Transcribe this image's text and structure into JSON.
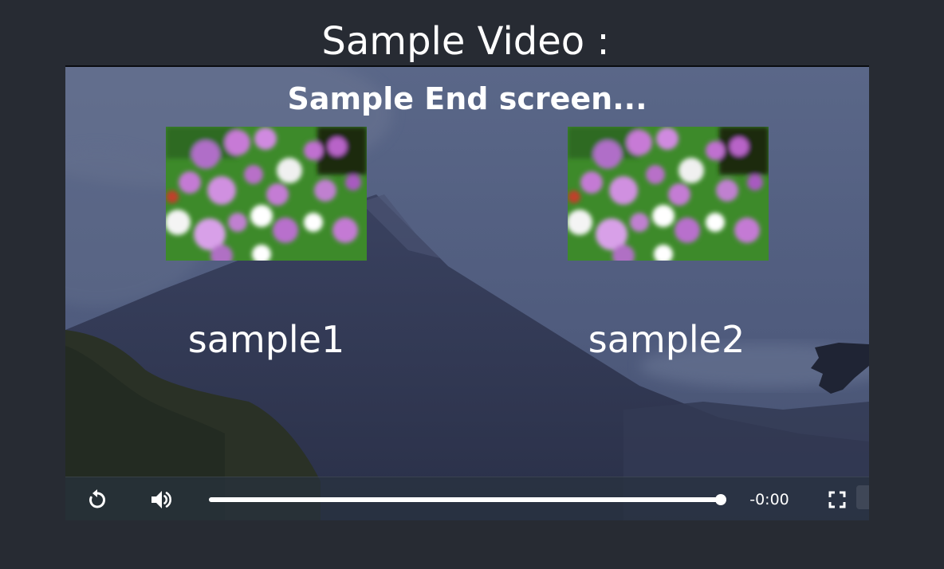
{
  "page": {
    "title": "Sample Video :"
  },
  "player": {
    "end_screen": {
      "title": "Sample End screen...",
      "items": [
        {
          "label": "sample1"
        },
        {
          "label": "sample2"
        }
      ]
    },
    "controls": {
      "replay_icon": "replay-icon",
      "volume_icon": "volume-icon",
      "fullscreen_icon": "fullscreen-icon",
      "time_remaining": "-0:00",
      "progress": 1.0
    }
  },
  "colors": {
    "page_background": "#272b33",
    "text": "#ffffff"
  }
}
